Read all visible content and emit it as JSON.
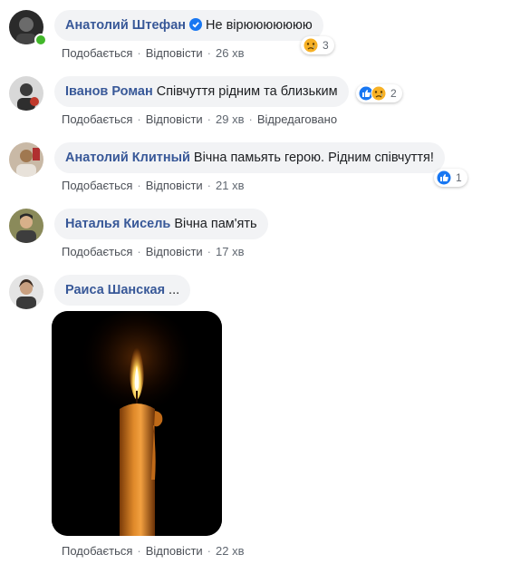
{
  "comments": [
    {
      "author": "Анатолий Штефан",
      "text": "Не вірююююююю",
      "verified": true,
      "online": true,
      "actions": {
        "like": "Подобається",
        "reply": "Відповісти",
        "time": "26 хв",
        "edited": ""
      },
      "reactions": {
        "icons": [
          "sad-icon"
        ],
        "count": "3"
      }
    },
    {
      "author": "Іванов Роман",
      "text": "Співчуття рідним та близьким",
      "verified": false,
      "online": false,
      "actions": {
        "like": "Подобається",
        "reply": "Відповісти",
        "time": "29 хв",
        "edited": "Відредаговано"
      },
      "reactions": {
        "icons": [
          "like-icon",
          "sad-icon"
        ],
        "count": "2"
      }
    },
    {
      "author": "Анатолий Клитный",
      "text": "Вічна памьять герою. Рідним співчуття!",
      "verified": false,
      "online": false,
      "actions": {
        "like": "Подобається",
        "reply": "Відповісти",
        "time": "21 хв",
        "edited": ""
      },
      "reactions": {
        "icons": [
          "like-icon"
        ],
        "count": "1"
      }
    },
    {
      "author": "Наталья Кисель",
      "text": "Вічна пам'ять",
      "verified": false,
      "online": false,
      "actions": {
        "like": "Подобається",
        "reply": "Відповісти",
        "time": "17 хв",
        "edited": ""
      },
      "reactions": null
    },
    {
      "author": "Раиса Шанская",
      "text": "...",
      "verified": false,
      "online": false,
      "actions": {
        "like": "Подобається",
        "reply": "Відповісти",
        "time": "22 хв",
        "edited": ""
      },
      "reactions": null,
      "attachment": "candle-photo"
    }
  ],
  "colors": {
    "author": "#385898",
    "bubble": "#f2f3f5",
    "like_blue": "#1877f2",
    "sad_yellow": "#f7b125",
    "online_green": "#42b72a"
  }
}
